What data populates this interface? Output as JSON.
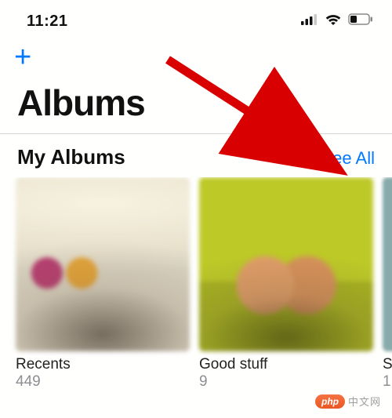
{
  "status": {
    "time": "11:21"
  },
  "header": {
    "add_label": "+",
    "title": "Albums"
  },
  "section": {
    "title": "My Albums",
    "see_all": "See All"
  },
  "albums": [
    {
      "title": "Recents",
      "count": "449"
    },
    {
      "title": "Good stuff",
      "count": "9"
    },
    {
      "title": "S",
      "count": "1"
    }
  ],
  "watermark": {
    "bubble": "php",
    "text": "中文网"
  }
}
